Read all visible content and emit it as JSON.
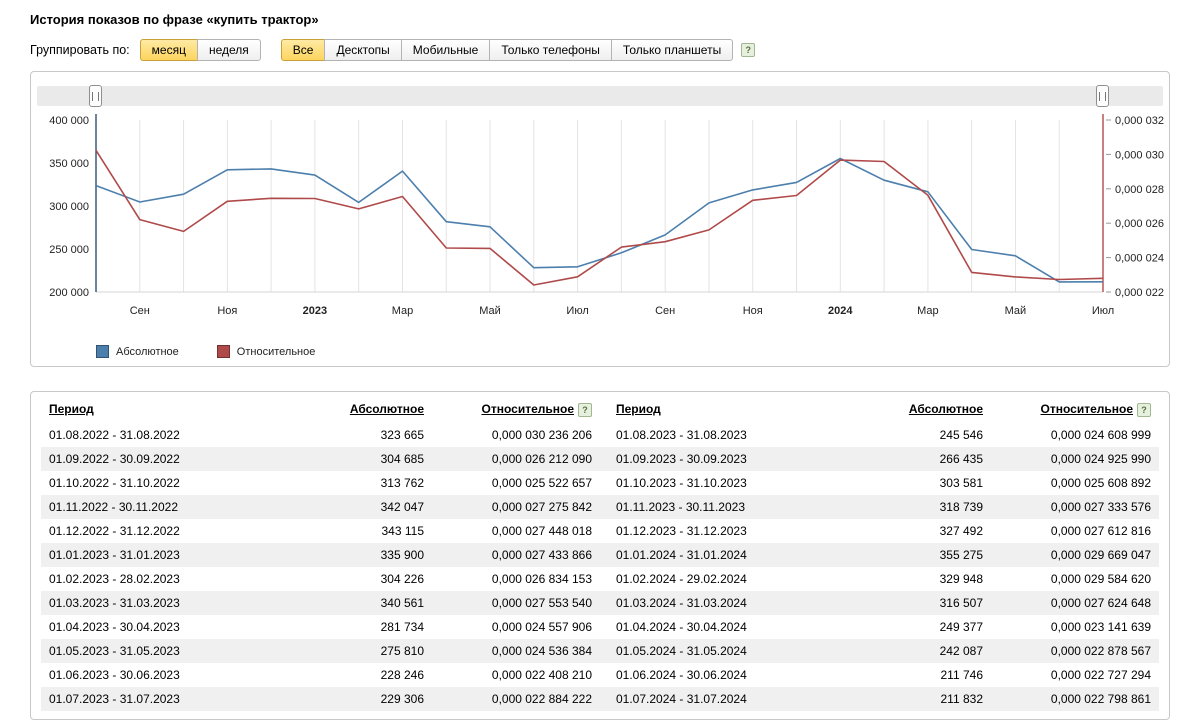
{
  "page": {
    "title": "История показов по фразе «купить трактор»"
  },
  "icons": {
    "help": "?"
  },
  "colors": {
    "active_filter_bg": "#fdd55e",
    "absolute_series": "#4c7fac",
    "relative_series": "#b04a4a",
    "gridline": "#e3e3e3"
  },
  "filters": {
    "group_label": "Группировать по:",
    "group_options": [
      {
        "label": "месяц",
        "active": true
      },
      {
        "label": "неделя",
        "active": false
      }
    ],
    "device_options": [
      {
        "label": "Все",
        "active": true
      },
      {
        "label": "Десктопы",
        "active": false
      },
      {
        "label": "Мобильные",
        "active": false
      },
      {
        "label": "Только телефоны",
        "active": false
      },
      {
        "label": "Только планшеты",
        "active": false
      }
    ]
  },
  "chart_data": {
    "type": "line",
    "months": [
      "08.2022",
      "09.2022",
      "10.2022",
      "11.2022",
      "12.2022",
      "01.2023",
      "02.2023",
      "03.2023",
      "04.2023",
      "05.2023",
      "06.2023",
      "07.2023",
      "08.2023",
      "09.2023",
      "10.2023",
      "11.2023",
      "12.2023",
      "01.2024",
      "02.2024",
      "03.2024",
      "04.2024",
      "05.2024",
      "06.2024",
      "07.2024"
    ],
    "x_ticks": [
      {
        "i": 1,
        "label": "Сен",
        "bold": false
      },
      {
        "i": 3,
        "label": "Ноя",
        "bold": false
      },
      {
        "i": 5,
        "label": "2023",
        "bold": true
      },
      {
        "i": 7,
        "label": "Мар",
        "bold": false
      },
      {
        "i": 9,
        "label": "Май",
        "bold": false
      },
      {
        "i": 11,
        "label": "Июл",
        "bold": false
      },
      {
        "i": 13,
        "label": "Сен",
        "bold": false
      },
      {
        "i": 15,
        "label": "Ноя",
        "bold": false
      },
      {
        "i": 17,
        "label": "2024",
        "bold": true
      },
      {
        "i": 19,
        "label": "Мар",
        "bold": false
      },
      {
        "i": 21,
        "label": "Май",
        "bold": false
      },
      {
        "i": 23,
        "label": "Июл",
        "bold": false
      }
    ],
    "left_axis": {
      "min": 200000,
      "max": 400000,
      "ticks": [
        {
          "v": 400000,
          "label": "400 000"
        },
        {
          "v": 350000,
          "label": "350 000"
        },
        {
          "v": 300000,
          "label": "300 000"
        },
        {
          "v": 250000,
          "label": "250 000"
        },
        {
          "v": 200000,
          "label": "200 000"
        }
      ]
    },
    "right_axis": {
      "min": 2.2e-05,
      "max": 3.2e-05,
      "ticks": [
        {
          "v": 3.2e-05,
          "label": "0,000 032"
        },
        {
          "v": 3e-05,
          "label": "0,000 030"
        },
        {
          "v": 2.8e-05,
          "label": "0,000 028"
        },
        {
          "v": 2.6e-05,
          "label": "0,000 026"
        },
        {
          "v": 2.4e-05,
          "label": "0,000 024"
        },
        {
          "v": 2.2e-05,
          "label": "0,000 022"
        }
      ]
    },
    "grid": "vertical-monthly",
    "legend_position": "bottom-left",
    "series": [
      {
        "name": "Абсолютное",
        "axis": "left",
        "color": "#4c7fac",
        "values": [
          323665,
          304685,
          313762,
          342047,
          343115,
          335900,
          304226,
          340561,
          281734,
          275810,
          228246,
          229306,
          245546,
          266435,
          303581,
          318739,
          327492,
          355275,
          329948,
          316507,
          249377,
          242087,
          211746,
          211832
        ]
      },
      {
        "name": "Относительное",
        "axis": "right",
        "color": "#b04a4a",
        "values": [
          3.0236206e-05,
          2.621209e-05,
          2.5522657e-05,
          2.7275842e-05,
          2.7448018e-05,
          2.7433866e-05,
          2.6834153e-05,
          2.755354e-05,
          2.4557906e-05,
          2.4536384e-05,
          2.240821e-05,
          2.2884222e-05,
          2.4608999e-05,
          2.492599e-05,
          2.5608892e-05,
          2.7333576e-05,
          2.7612816e-05,
          2.9669047e-05,
          2.958462e-05,
          2.7624648e-05,
          2.3141639e-05,
          2.2878567e-05,
          2.2727294e-05,
          2.2798861e-05
        ]
      }
    ]
  },
  "tables": {
    "headers": {
      "period": "Период",
      "absolute": "Абсолютное",
      "relative": "Относительное"
    },
    "left_rows": [
      {
        "period": "01.08.2022 - 31.08.2022",
        "abs": "323 665",
        "rel": "0,000 030 236 206"
      },
      {
        "period": "01.09.2022 - 30.09.2022",
        "abs": "304 685",
        "rel": "0,000 026 212 090"
      },
      {
        "period": "01.10.2022 - 31.10.2022",
        "abs": "313 762",
        "rel": "0,000 025 522 657"
      },
      {
        "period": "01.11.2022 - 30.11.2022",
        "abs": "342 047",
        "rel": "0,000 027 275 842"
      },
      {
        "period": "01.12.2022 - 31.12.2022",
        "abs": "343 115",
        "rel": "0,000 027 448 018"
      },
      {
        "period": "01.01.2023 - 31.01.2023",
        "abs": "335 900",
        "rel": "0,000 027 433 866"
      },
      {
        "period": "01.02.2023 - 28.02.2023",
        "abs": "304 226",
        "rel": "0,000 026 834 153"
      },
      {
        "period": "01.03.2023 - 31.03.2023",
        "abs": "340 561",
        "rel": "0,000 027 553 540"
      },
      {
        "period": "01.04.2023 - 30.04.2023",
        "abs": "281 734",
        "rel": "0,000 024 557 906"
      },
      {
        "period": "01.05.2023 - 31.05.2023",
        "abs": "275 810",
        "rel": "0,000 024 536 384"
      },
      {
        "period": "01.06.2023 - 30.06.2023",
        "abs": "228 246",
        "rel": "0,000 022 408 210"
      },
      {
        "period": "01.07.2023 - 31.07.2023",
        "abs": "229 306",
        "rel": "0,000 022 884 222"
      }
    ],
    "right_rows": [
      {
        "period": "01.08.2023 - 31.08.2023",
        "abs": "245 546",
        "rel": "0,000 024 608 999"
      },
      {
        "period": "01.09.2023 - 30.09.2023",
        "abs": "266 435",
        "rel": "0,000 024 925 990"
      },
      {
        "period": "01.10.2023 - 31.10.2023",
        "abs": "303 581",
        "rel": "0,000 025 608 892"
      },
      {
        "period": "01.11.2023 - 30.11.2023",
        "abs": "318 739",
        "rel": "0,000 027 333 576"
      },
      {
        "period": "01.12.2023 - 31.12.2023",
        "abs": "327 492",
        "rel": "0,000 027 612 816"
      },
      {
        "period": "01.01.2024 - 31.01.2024",
        "abs": "355 275",
        "rel": "0,000 029 669 047"
      },
      {
        "period": "01.02.2024 - 29.02.2024",
        "abs": "329 948",
        "rel": "0,000 029 584 620"
      },
      {
        "period": "01.03.2024 - 31.03.2024",
        "abs": "316 507",
        "rel": "0,000 027 624 648"
      },
      {
        "period": "01.04.2024 - 30.04.2024",
        "abs": "249 377",
        "rel": "0,000 023 141 639"
      },
      {
        "period": "01.05.2024 - 31.05.2024",
        "abs": "242 087",
        "rel": "0,000 022 878 567"
      },
      {
        "period": "01.06.2024 - 30.06.2024",
        "abs": "211 746",
        "rel": "0,000 022 727 294"
      },
      {
        "period": "01.07.2024 - 31.07.2024",
        "abs": "211 832",
        "rel": "0,000 022 798 861"
      }
    ]
  }
}
